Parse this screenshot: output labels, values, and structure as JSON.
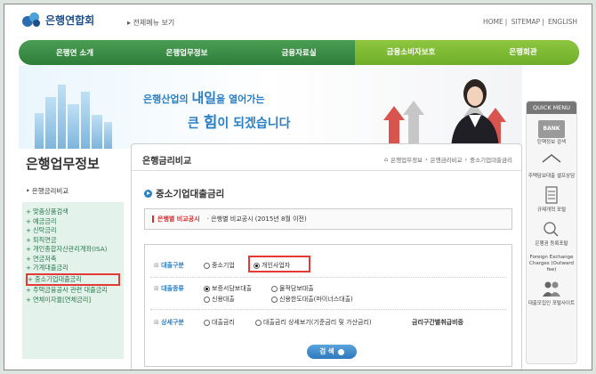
{
  "header": {
    "logo_text": "은행연합회",
    "all_menu": "전체메뉴 보기",
    "links": [
      "HOME",
      "SITEMAP",
      "ENGLISH"
    ]
  },
  "nav": {
    "items": [
      "은행연 소개",
      "은행업무정보",
      "금융자료실",
      "금융소비자보호",
      "은행회관"
    ]
  },
  "banner": {
    "slogan_line1_a": "은행산업의 ",
    "slogan_line1_b": "내일",
    "slogan_line1_c": "을 열어가는",
    "slogan_line2_a": "큰 ",
    "slogan_line2_b": "힘",
    "slogan_line2_c": "이 되겠습니다"
  },
  "quick_menu": {
    "title": "QUICK MENU",
    "items": [
      {
        "icon": "bank-icon",
        "label": "BANK"
      },
      {
        "icon": "bank-icon",
        "label": "탄핵정보 검색"
      },
      {
        "icon": "house-icon",
        "label": "주택담보대출 셀프상담"
      },
      {
        "icon": "document-icon",
        "label": "규제개혁 포털"
      },
      {
        "icon": "search-person-icon",
        "label": "은행권 등록포탈"
      },
      {
        "icon": "",
        "label": "Foreign Exchange Charges (Outward fee)"
      },
      {
        "icon": "people-icon",
        "label": "대출모집인 포털사이트"
      }
    ]
  },
  "sidebar": {
    "title": "은행업무정보",
    "sub": "• 은행금리비교",
    "items": [
      "맞춤상품검색",
      "예금금리",
      "신탁금리",
      "퇴직연금",
      "개인종합자산관리계좌(ISA)",
      "연금저축",
      "가계대출금리",
      "중소기업대출금리",
      "주택금융공사 관련 대출금리",
      "연체이자율[연체금리]"
    ],
    "active_index": 7
  },
  "main": {
    "title": "은행금리비교",
    "breadcrumb": [
      "은행업무정보",
      "은행금리비교",
      "중소기업대출금리"
    ],
    "section_title": "중소기업대출금리",
    "tabs": [
      "은행별 비교공시",
      "· 은행별 비교공시 (2015년 8월 이전)"
    ],
    "form": {
      "row1_label": "대출구분",
      "row1_opts": [
        "중소기업",
        "개인사업자"
      ],
      "row2_label": "대출종류",
      "row2_opts": [
        "보증서담보대출",
        "물적담보대출",
        "신용대출",
        "신용한도대출(마이너스대출)"
      ],
      "row3_label": "상세구분",
      "row3_opts": [
        "대출금리",
        "대출금리 상세보기(기준금리 및 가산금리)",
        "금리구간별취급비중"
      ],
      "search": "검 색"
    }
  }
}
